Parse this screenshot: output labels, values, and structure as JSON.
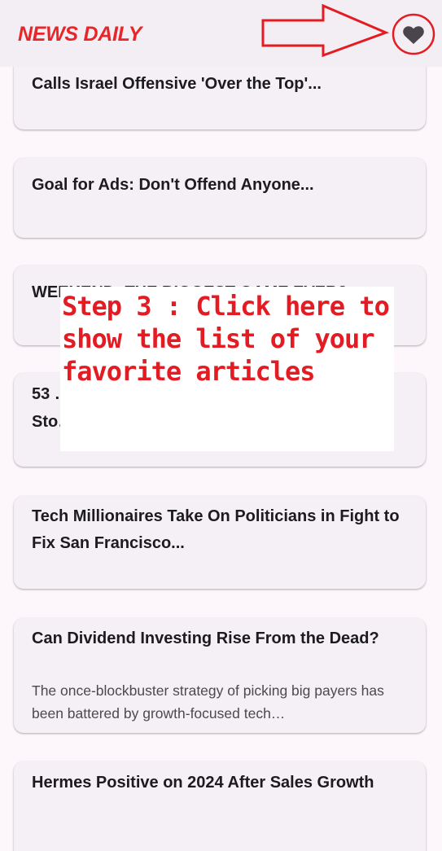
{
  "app": {
    "title": "NEWS DAILY",
    "accent_color": "#e8262a",
    "favorites_icon": "heart-icon"
  },
  "articles": [
    {
      "title": "Calls Israel Offensive 'Over the Top'...",
      "description": ""
    },
    {
      "title": "Goal for Ads: Don't Offend Anyone...",
      "description": ""
    },
    {
      "title": "WEEKEND: THE BIGGEST GAME EVER?",
      "description": ""
    },
    {
      "title": "53 …",
      "line2": "Sto…",
      "description": ""
    },
    {
      "title": "Tech Millionaires Take On Politicians in Fight to Fix San Francisco...",
      "description": ""
    },
    {
      "title": "Can Dividend Investing Rise From the Dead?",
      "description": "The once-blockbuster strategy of picking big payers has been battered by growth-focused tech…"
    },
    {
      "title": "Hermes Positive on 2024 After Sales Growth",
      "description": ""
    }
  ],
  "annotation": {
    "text": "Step 3 : Click here to show the list of your favorite articles",
    "color": "#e31b23"
  }
}
